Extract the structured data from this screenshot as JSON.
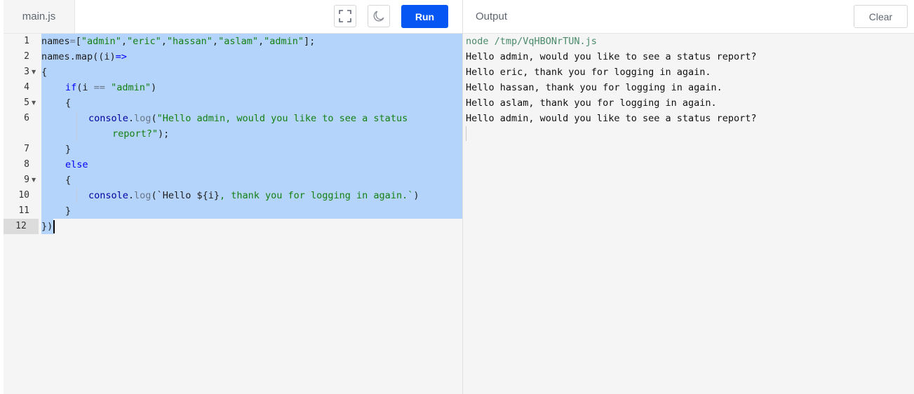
{
  "editor": {
    "file_tab": "main.js",
    "run_label": "Run",
    "fullscreen_icon": "fullscreen-icon",
    "theme_icon": "moon-icon",
    "lines": [
      {
        "n": "1",
        "fold": false
      },
      {
        "n": "2",
        "fold": false
      },
      {
        "n": "3",
        "fold": true
      },
      {
        "n": "4",
        "fold": false
      },
      {
        "n": "5",
        "fold": true
      },
      {
        "n": "6",
        "fold": false
      },
      {
        "n": "",
        "fold": false
      },
      {
        "n": "7",
        "fold": false
      },
      {
        "n": "8",
        "fold": false
      },
      {
        "n": "9",
        "fold": true
      },
      {
        "n": "10",
        "fold": false
      },
      {
        "n": "11",
        "fold": false
      },
      {
        "n": "12",
        "fold": false
      }
    ],
    "code": {
      "l1_a": "names",
      "l1_b": "=",
      "l1_c": "[",
      "l1_d": "\"admin\"",
      "l1_e": ",",
      "l1_f": "\"eric\"",
      "l1_g": "\"hassan\"",
      "l1_h": "\"aslam\"",
      "l1_i": "\"admin\"",
      "l1_j": "];",
      "l2_a": "names.map((i)",
      "l2_b": "=>",
      "l3": "{",
      "l4_a": "if",
      "l4_b": "(i ",
      "l4_c": "==",
      "l4_d": " ",
      "l4_e": "\"admin\"",
      "l4_f": ")",
      "l5": "{",
      "l6_a": "console",
      "l6_b": ".",
      "l6_c": "log",
      "l6_d": "(",
      "l6_e": "\"Hello admin, would you like to see a status",
      "l6w_a": "report?\"",
      "l6w_b": ");",
      "l7": "}",
      "l8": "else",
      "l9": "{",
      "l10_a": "console",
      "l10_b": ".",
      "l10_c": "log",
      "l10_d": "(",
      "l10_e": "`Hello ${i}",
      "l10_f": ", thank you for logging in again.`",
      "l10_g": ")",
      "l11": "}",
      "l12": "})"
    }
  },
  "output": {
    "title": "Output",
    "clear_label": "Clear",
    "command": "node /tmp/VqHBONrTUN.js",
    "lines": [
      "Hello admin, would you like to see a status report?",
      "Hello eric, thank you for logging in again.",
      "Hello hassan, thank you for logging in again.",
      "Hello aslam, thank you for logging in again.",
      "Hello admin, would you like to see a status report?"
    ]
  },
  "colors": {
    "run_button": "#0556f3",
    "selection": "#b4d4fb",
    "string": "#138013",
    "keyword": "#0000ff"
  }
}
